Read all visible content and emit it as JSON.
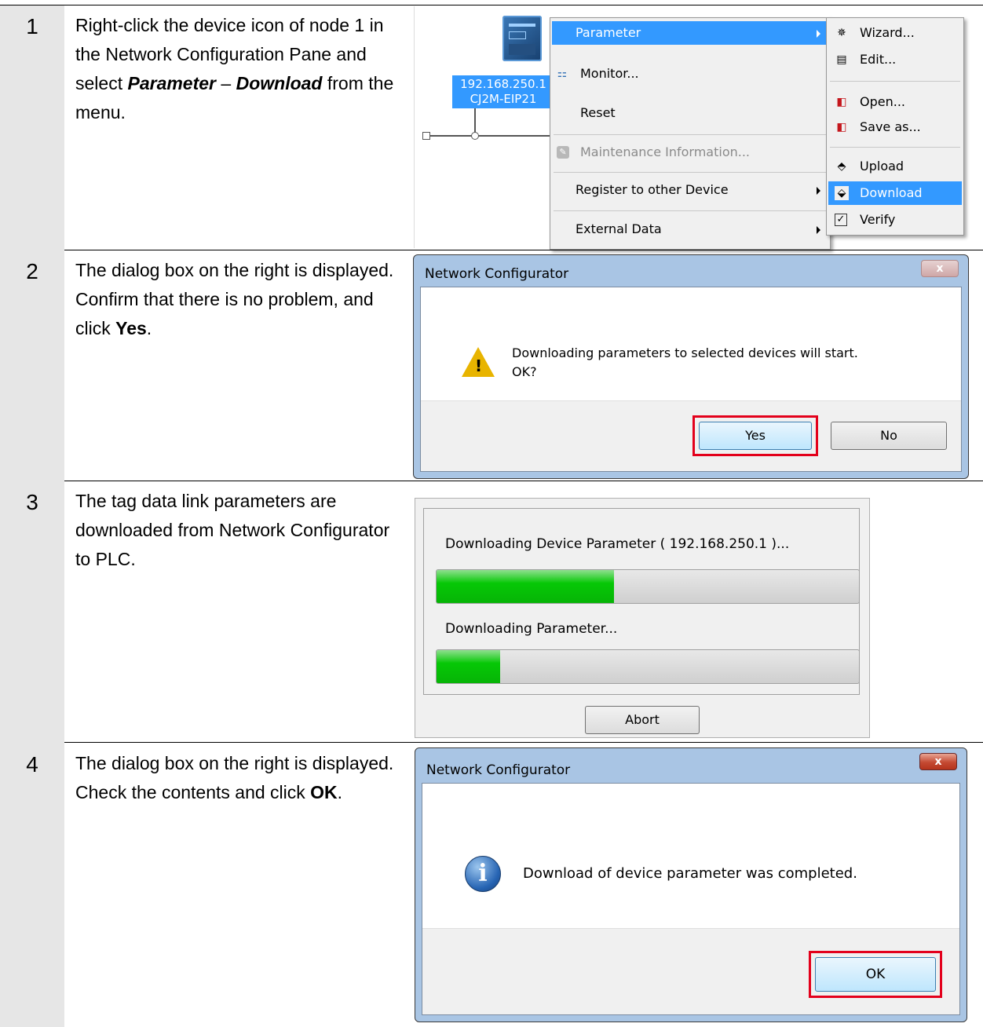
{
  "steps": [
    {
      "num": "1",
      "text_pre": "Right-click the device icon of node 1 in the Network Configuration Pane and select ",
      "text_b1": "Parameter",
      "text_mid": " – ",
      "text_b2": "Download",
      "text_post": " from the menu."
    },
    {
      "num": "2",
      "text_pre": "The dialog box on the right is displayed. Confirm that there is no problem, and click ",
      "text_b": "Yes",
      "text_post": "."
    },
    {
      "num": "3",
      "text": "The tag data link parameters are downloaded from Network Configurator to PLC."
    },
    {
      "num": "4",
      "text_pre": "The dialog box on the right is displayed. Check the contents and click ",
      "text_b": "OK",
      "text_post": "."
    }
  ],
  "network": {
    "device_ip": "192.168.250.1",
    "device_model": "CJ2M-EIP21"
  },
  "context_menu": {
    "items": [
      "Parameter",
      "Monitor...",
      "Reset",
      "Maintenance Information...",
      "Register to other Device",
      "External Data"
    ]
  },
  "sub_menu": {
    "items": [
      "Wizard...",
      "Edit...",
      "Open...",
      "Save as...",
      "Upload",
      "Download",
      "Verify"
    ]
  },
  "dialog_confirm": {
    "title": "Network Configurator",
    "message_line1": "Downloading parameters to selected devices will start.",
    "message_line2": "OK?",
    "yes_label": "Yes",
    "no_label": "No"
  },
  "progress_dialog": {
    "label1": "Downloading Device Parameter ( 192.168.250.1 )...",
    "progress1": 0.42,
    "label2": "Downloading Parameter...",
    "progress2": 0.15,
    "abort_label": "Abort"
  },
  "dialog_complete": {
    "title": "Network Configurator",
    "message": "Download of device parameter was completed.",
    "ok_label": "OK"
  },
  "colors": {
    "highlight": "#3399ff",
    "progress_green": "#06c806",
    "red_frame": "#e3001b"
  }
}
